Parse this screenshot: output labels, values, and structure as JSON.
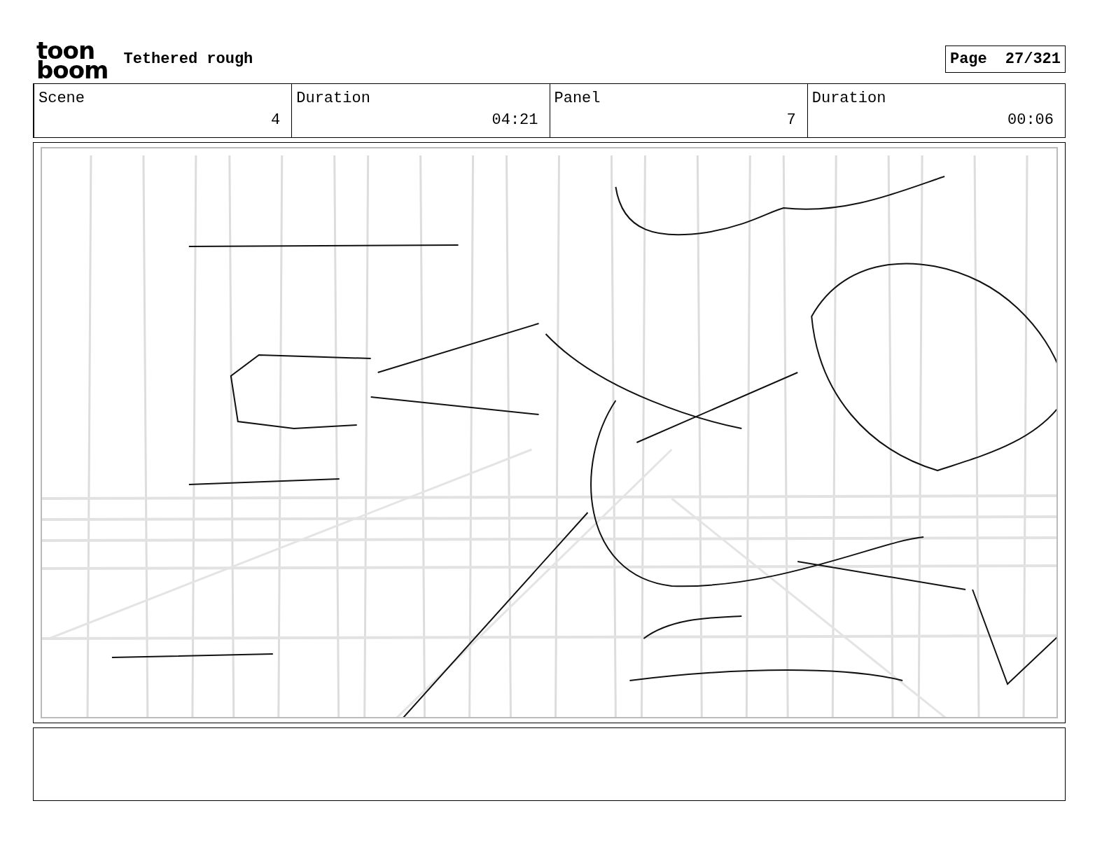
{
  "header": {
    "logo": [
      "toon",
      "boom"
    ],
    "title": "Tethered rough",
    "page_label": "Page",
    "page_number": "27/321"
  },
  "info": [
    {
      "label": "Scene",
      "value": "4"
    },
    {
      "label": "Duration",
      "value": "04:21"
    },
    {
      "label": "Panel",
      "value": "7"
    },
    {
      "label": "Duration",
      "value": "00:06"
    }
  ],
  "panel": {
    "kind": "sketch"
  }
}
